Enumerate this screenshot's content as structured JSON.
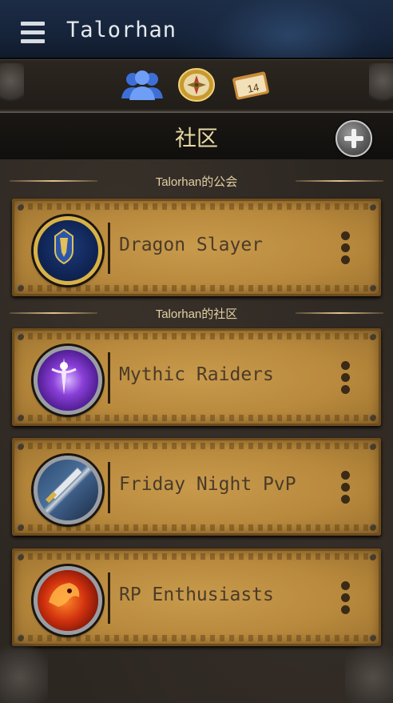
{
  "app": {
    "title": "Talorhan"
  },
  "iconbar": {
    "icons": [
      "people-icon",
      "compass-icon",
      "calendar-icon"
    ],
    "calendar_day": "14"
  },
  "section": {
    "title": "社区",
    "add_icon": "plus-icon"
  },
  "guild_group": {
    "label": "Talorhan的公会",
    "items": [
      {
        "name": "Dragon Slayer",
        "emblem": "alliance-emblem-icon"
      }
    ]
  },
  "community_group": {
    "label": "Talorhan的社区",
    "items": [
      {
        "name": "Mythic Raiders",
        "emblem": "arcane-emblem-icon"
      },
      {
        "name": "Friday Night PvP",
        "emblem": "sword-emblem-icon"
      },
      {
        "name": "RP Enthusiasts",
        "emblem": "beast-emblem-icon"
      }
    ]
  },
  "colors": {
    "topbar": "#16243a",
    "card": "#c89a4c",
    "title_gold": "#e9d9a6",
    "text_dark": "#4a3b29"
  }
}
